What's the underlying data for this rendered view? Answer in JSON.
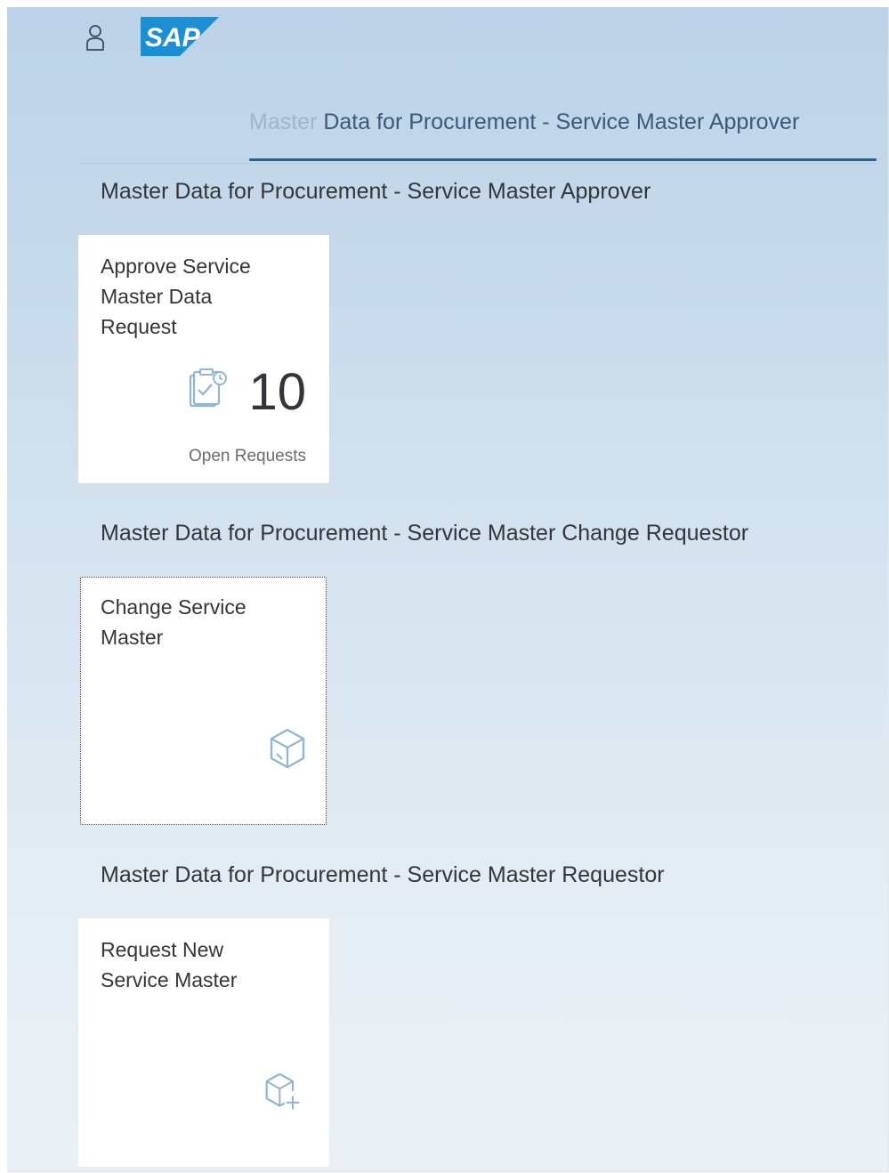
{
  "header": {
    "user_icon": "person-icon",
    "logo_text": "SAP",
    "logo_color": "#1a8fd6"
  },
  "anchor_bar": {
    "active_prefix": "Master",
    "active_rest": " Data for Procurement - Service Master Approver",
    "accent_color": "#2f5e87"
  },
  "groups": [
    {
      "title": "Master Data for Procurement - Service Master Approver",
      "tile": {
        "title": "Approve Service Master Data Request",
        "icon": "approval-request-icon",
        "kpi_value": "10",
        "kpi_unit": "Open Requests"
      }
    },
    {
      "title": "Master Data for Procurement - Service Master Change Requestor",
      "tile": {
        "title": "Change Service Master",
        "icon": "product-box-icon"
      }
    },
    {
      "title": "Master Data for Procurement - Service Master Requestor",
      "tile": {
        "title": "Request New Service Master",
        "icon": "product-box-add-icon"
      }
    }
  ]
}
